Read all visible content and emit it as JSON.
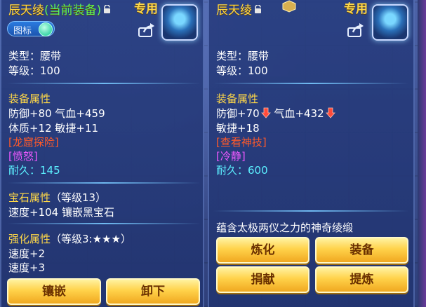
{
  "left_panel": {
    "item_name": "辰天绫",
    "equip_status": "(当前装备)",
    "exclusive_tag": "专用",
    "toggle_label": "图标",
    "type_line": "类型：腰带",
    "level_line": "等级：100",
    "equip_attr_header": "装备属性",
    "attr_line1": "防御+80 气血+459",
    "attr_line2": "体质+12 敏捷+11",
    "special_skill": "[龙窟探险]",
    "special_effect": "[愤怒]",
    "durability": "耐久：145",
    "gem_header": "宝石属性",
    "gem_level": "（等级13）",
    "gem_line": "速度+104 镶嵌黑宝石",
    "enhance_header": "强化属性",
    "enhance_level": "（等级3:★★★）",
    "enhance_line1": "速度+2",
    "enhance_line2": "速度+3",
    "buttons": {
      "inlay": "镶嵌",
      "unequip": "卸下"
    }
  },
  "right_panel": {
    "item_name": "辰天绫",
    "exclusive_tag": "专用",
    "type_line": "类型：腰带",
    "level_line": "等级：100",
    "equip_attr_header": "装备属性",
    "attr_def": "防御+70",
    "attr_hp": "气血+432",
    "attr_line2": "敏捷+18",
    "special_skill": "[查看神技]",
    "special_effect": "[冷静]",
    "durability": "耐久：600",
    "description": "蕴含太极两仪之力的神奇绫缎",
    "buttons": {
      "refine": "炼化",
      "equip": "装备",
      "donate": "捐献",
      "extract": "提炼"
    }
  },
  "colors": {
    "gold_text": "#ffd848",
    "equipped_green": "#5cf55c",
    "special_red": "#ff5a2a",
    "effect_pink": "#ee58ff",
    "durability_cyan": "#5cf0ff",
    "button_gold": "#ffd24a"
  },
  "icons": [
    "lock-icon",
    "tier-badge-icon",
    "share-icon",
    "item-belt-icon",
    "down-arrow-icon",
    "toggle-knob"
  ]
}
